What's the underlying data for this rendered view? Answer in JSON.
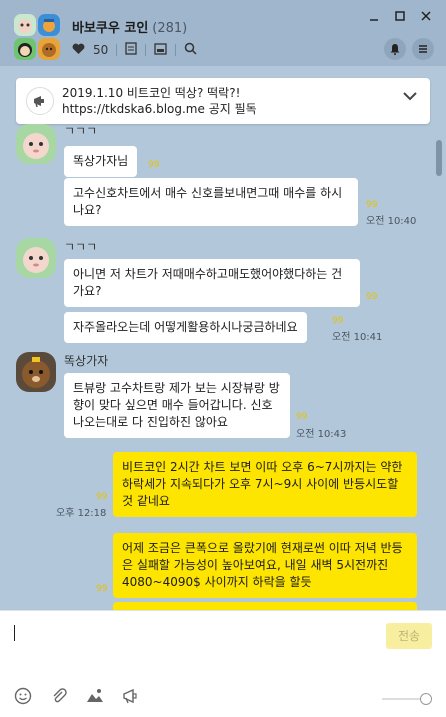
{
  "header": {
    "title": "바보쿠우 코인",
    "member_count": "(281)",
    "likes": "50",
    "icons": [
      "heart-icon",
      "note-icon",
      "album-icon",
      "search-icon",
      "bell-icon",
      "menu-icon"
    ],
    "window_controls": [
      "minimize-icon",
      "maximize-icon",
      "close-icon"
    ]
  },
  "notice": {
    "line1": "2019.1.10 비트코인 떡상? 떡락?!",
    "line2": "https://tkdska6.blog.me 공지 필독"
  },
  "messages": [
    {
      "id": "m1",
      "sender": "ㄱㄱㄱ",
      "text": "똑상가자님",
      "unread": "99",
      "time": ""
    },
    {
      "id": "m2",
      "sender": "",
      "text": "고수신호차트에서 매수 신호를보내면그때 매수를 하시나요?",
      "unread": "99",
      "time": "오전 10:40"
    },
    {
      "id": "m3",
      "sender": "ㄱㄱㄱ",
      "text": "아니면 저 차트가 저때매수하고매도했어야했다하는 건가요?",
      "unread": "99",
      "time": ""
    },
    {
      "id": "m4",
      "sender": "",
      "text": "자주올라오는데 어떻게활용하시나궁금하네요",
      "unread": "99",
      "time": "오전 10:41"
    },
    {
      "id": "m5",
      "sender": "똑상가자",
      "text": "트뷰랑 고수차트랑 제가 보는 시장뷰랑 방향이 맞다 싶으면 매수 들어갑니다. 신호 나오는대로 다 진입하진 않아요",
      "unread": "99",
      "time": "오전 10:43"
    },
    {
      "id": "m6",
      "sender": "",
      "text": "비트코인 2시간 차트 보면 이따 오후 6~7시까지는 약한 하락세가 지속되다가 오후 7시~9시 사이에 반등시도할 것 같네요",
      "unread": "99",
      "time": "오후 12:18"
    },
    {
      "id": "m7",
      "sender": "",
      "text": "어제 조금은 큰폭으로 올랐기에 현재로썬 이따 저녁 반등은 실패할 가능성이 높아보여요, 내일 새벽 5시전까진 4080~4090$ 사이까지 하락을 할듯",
      "unread": "99",
      "time": ""
    }
  ],
  "input": {
    "send_label": "전송",
    "toolbar": [
      "emoticon-icon",
      "attach-icon",
      "image-icon",
      "megaphone-icon"
    ]
  },
  "colors": {
    "header_bg": "#9fb6cd",
    "chat_bg": "#b2c7d9",
    "my_bubble": "#fee500",
    "unread": "#e8c100"
  }
}
